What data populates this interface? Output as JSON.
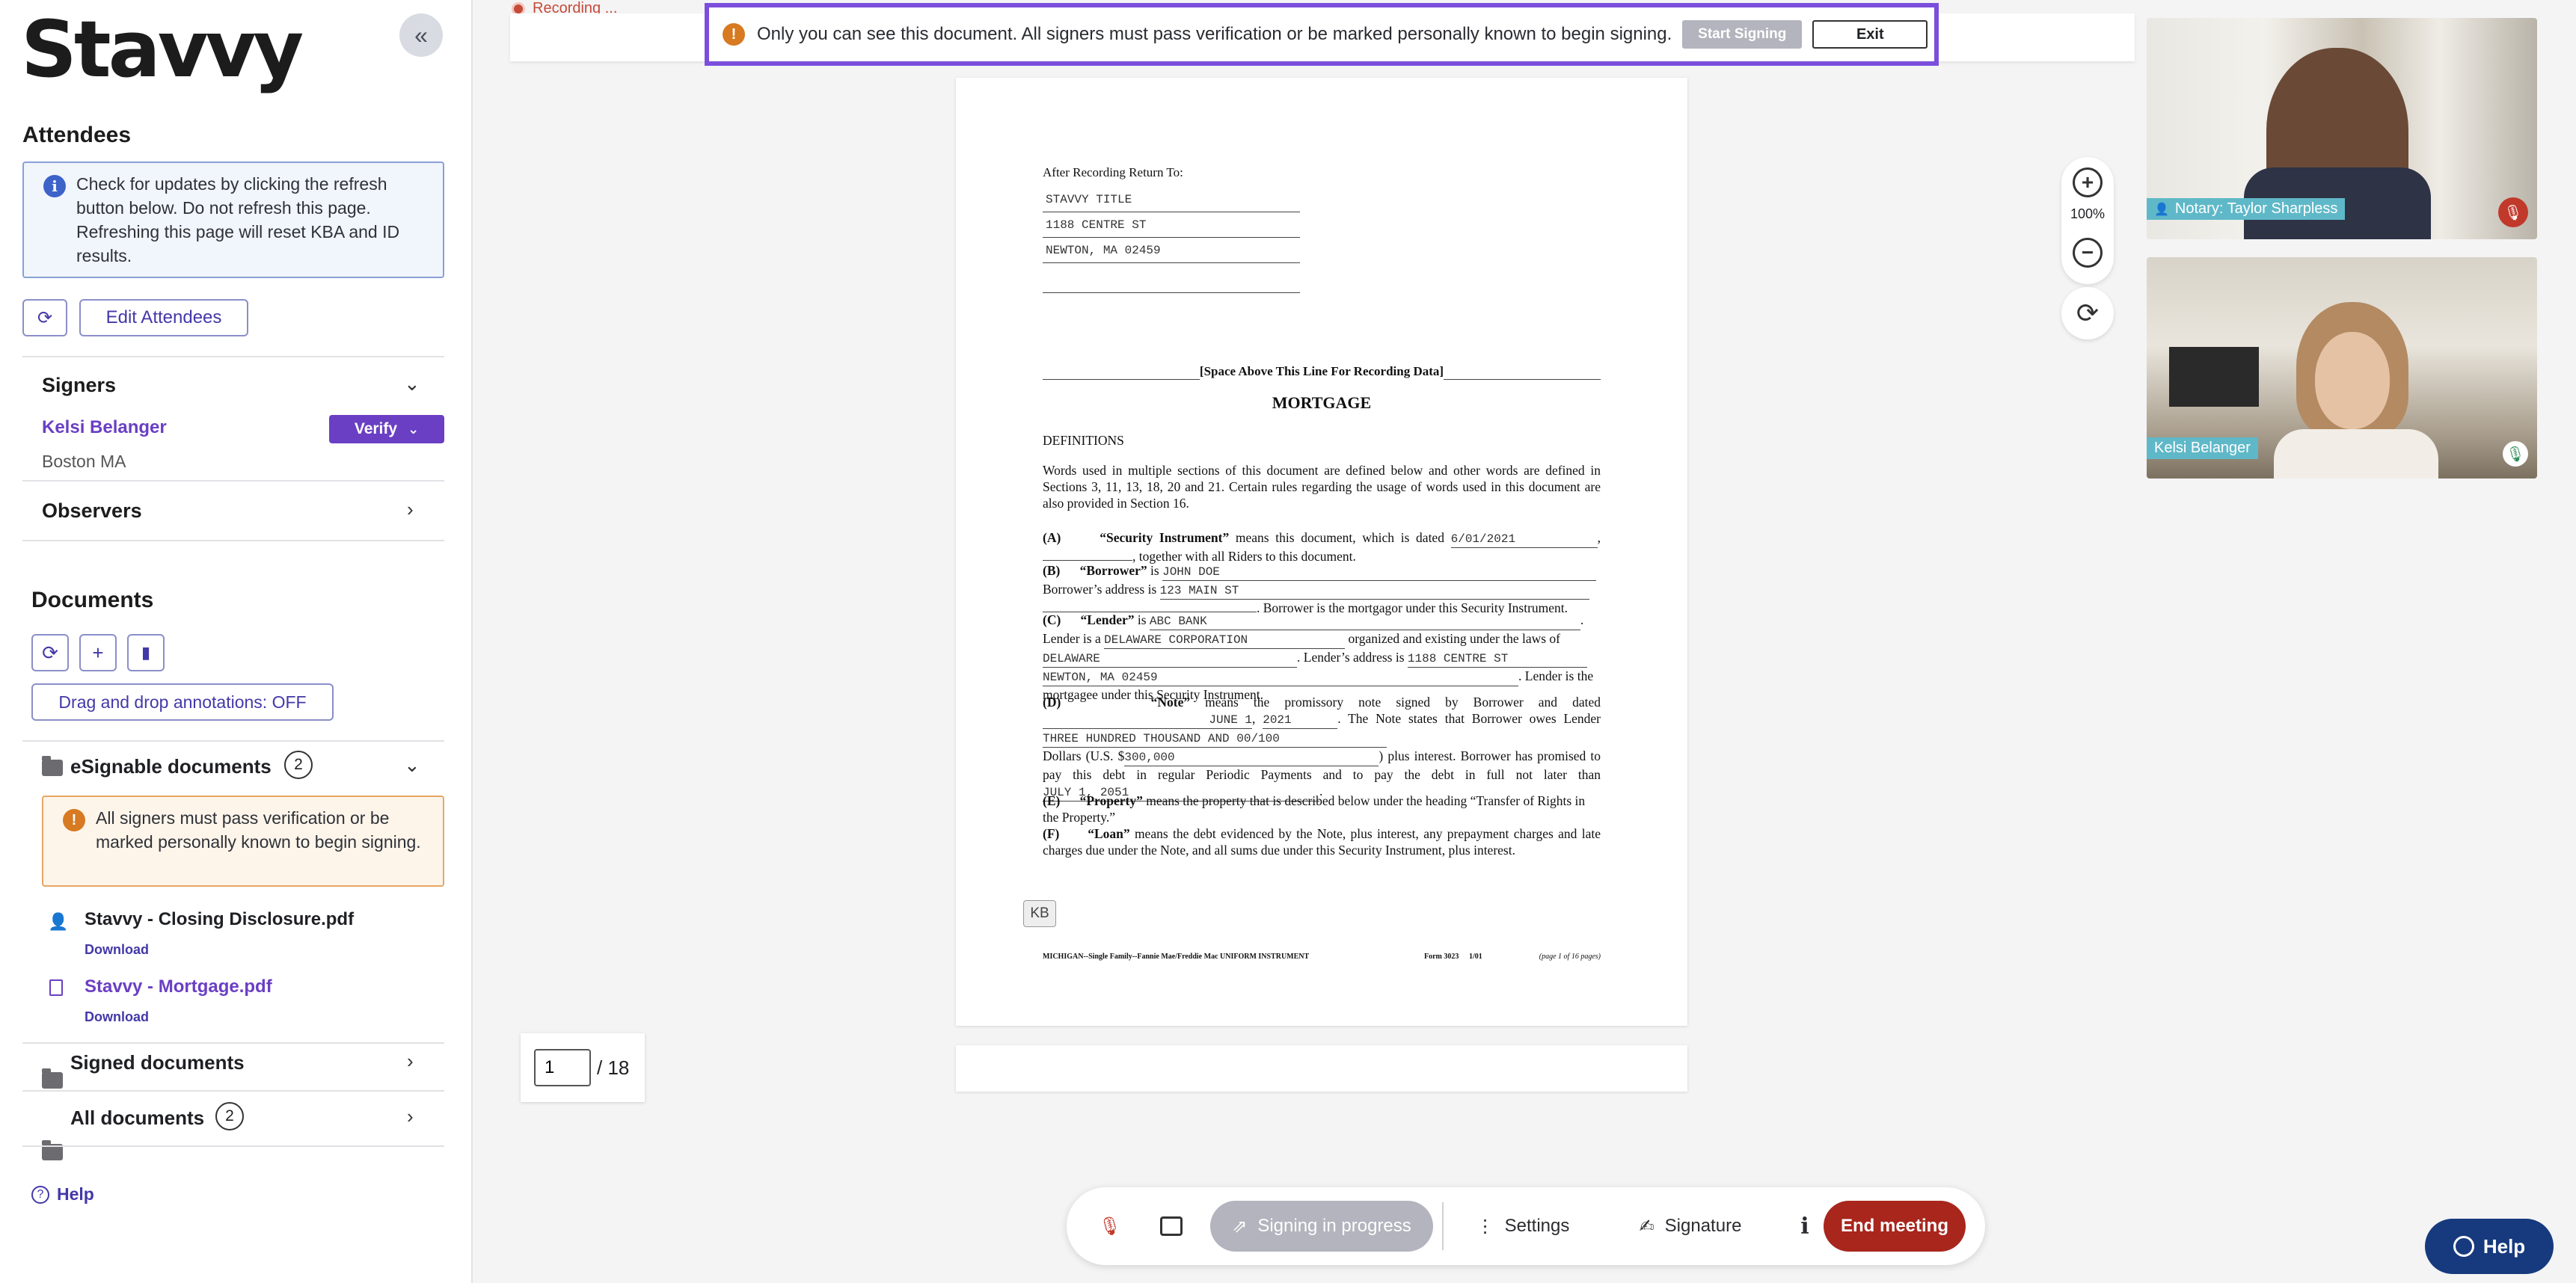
{
  "app": {
    "logo": "Stavvy"
  },
  "sidebar": {
    "collapse_icon": "«",
    "attendees_title": "Attendees",
    "info_text": "Check for updates by clicking the refresh button below. Do not refresh this page. Refreshing this page will reset KBA and ID results.",
    "edit_attendees": "Edit Attendees",
    "signers_title": "Signers",
    "signer": {
      "name": "Kelsi Belanger",
      "location": "Boston MA",
      "verify_label": "Verify"
    },
    "observers_title": "Observers",
    "documents_title": "Documents",
    "drag_drop_label": "Drag and drop annotations: OFF",
    "esignable": {
      "label": "eSignable documents",
      "count": "2"
    },
    "warning_text": "All signers must pass verification or be marked personally known to begin signing.",
    "docs": [
      {
        "name": "Stavvy - Closing Disclosure.pdf",
        "download": "Download"
      },
      {
        "name": "Stavvy - Mortgage.pdf",
        "download": "Download"
      }
    ],
    "signed": {
      "label": "Signed documents"
    },
    "all_docs": {
      "label": "All documents",
      "count": "2"
    },
    "help": "Help"
  },
  "banner": {
    "recording": "Recording ...",
    "message": "Only you can see this document. All signers must pass verification or be marked personally known to begin signing.",
    "start_signing": "Start Signing",
    "exit": "Exit"
  },
  "document": {
    "return_to": "After Recording Return To:",
    "address": [
      "STAVVY TITLE",
      "1188 CENTRE ST",
      "NEWTON, MA 02459",
      ""
    ],
    "space_above": "[Space Above This Line For Recording Data]",
    "title": "MORTGAGE",
    "definitions": "DEFINITIONS",
    "intro": "Words used in multiple sections of this document are defined below and other words are defined in Sections 3, 11, 13, 18, 20 and 21.  Certain rules regarding the usage of words used in this document are also provided in Section 16.",
    "date": "6/01/2021",
    "borrower": "JOHN DOE",
    "borrower_address": "123 MAIN ST",
    "lender": "ABC BANK",
    "lender_type": "DELAWARE CORPORATION",
    "lender_state": "DELAWARE",
    "lender_address": "1188 CENTRE ST",
    "lender_city": "NEWTON, MA 02459",
    "note_date_month": "JUNE 1",
    "note_date_year": "2021",
    "note_amount_words": "THREE HUNDRED THOUSAND AND 00/100",
    "note_amount": "300,000",
    "maturity": "JULY 1, 2051",
    "initials": "KB",
    "footer_left": "MICHIGAN--Single Family--Fannie Mae/Freddie Mac UNIFORM INSTRUMENT",
    "footer_form": "Form 3023",
    "footer_rev": "1/01",
    "footer_page": "(page 1 of 16 pages)"
  },
  "zoom": {
    "level": "100%"
  },
  "pager": {
    "current": "1",
    "total": "/ 18"
  },
  "videos": [
    {
      "label": "Notary: Taylor Sharpless"
    },
    {
      "label": "Kelsi Belanger"
    }
  ],
  "toolbar": {
    "signing": "Signing in progress",
    "settings": "Settings",
    "signature": "Signature",
    "info": "i",
    "end_meeting": "End meeting"
  },
  "help_fab": "Help",
  "colors": {
    "accent": "#6a3fc4",
    "banner_border": "#7b4fdc",
    "end_meeting": "#a8261c",
    "help": "#163a7d"
  }
}
